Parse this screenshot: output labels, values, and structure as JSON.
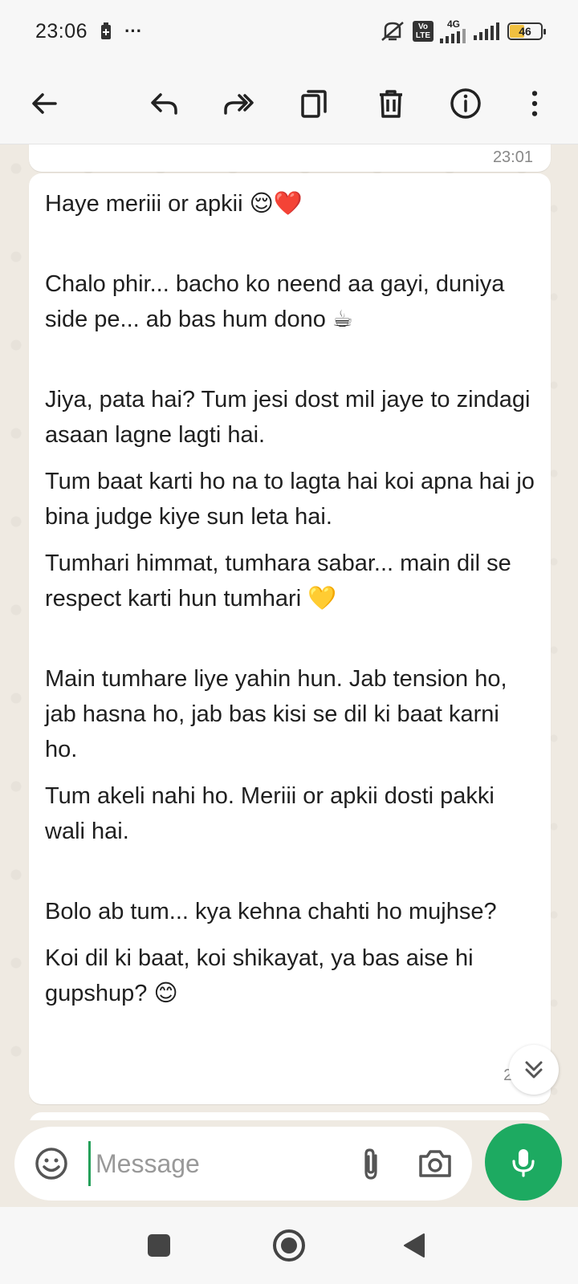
{
  "status_bar": {
    "time": "23:06",
    "overflow": "···",
    "network_label": "4G",
    "volte_label": "Vo LTE",
    "battery": "46"
  },
  "action_bar": {
    "icons": [
      "back-arrow-icon",
      "reply-icon",
      "forward-icon",
      "copy-icon",
      "delete-icon",
      "info-icon",
      "more-vert-icon"
    ]
  },
  "chat": {
    "previous_time": "23:01",
    "message_time": "23:0",
    "lines": [
      "Haye meriii or apkii 😌❤️",
      "Chalo phir... bacho ko neend aa gayi, duniya side pe... ab bas hum dono ☕",
      "Jiya, pata hai? Tum jesi dost mil jaye to zindagi asaan lagne lagti hai.",
      "Tum baat karti ho na to lagta hai koi apna hai jo bina judge kiye sun leta hai.",
      "Tumhari himmat, tumhara sabar... main dil se respect karti hun tumhari 💛",
      "Main tumhare liye yahin hun. Jab tension ho, jab hasna ho, jab bas kisi se dil ki baat karni ho.",
      "Tum akeli nahi ho. Meriii or apkii dosti pakki wali hai.",
      "Bolo ab tum... kya kehna chahti ho mujhse?",
      "Koi dil ki baat, koi shikayat, ya bas aise hi gupshup? 😊"
    ]
  },
  "input": {
    "placeholder": "Message",
    "value": ""
  },
  "colors": {
    "accent": "#1daa61",
    "chat_bg": "#efeae2",
    "bubble": "#ffffff"
  }
}
